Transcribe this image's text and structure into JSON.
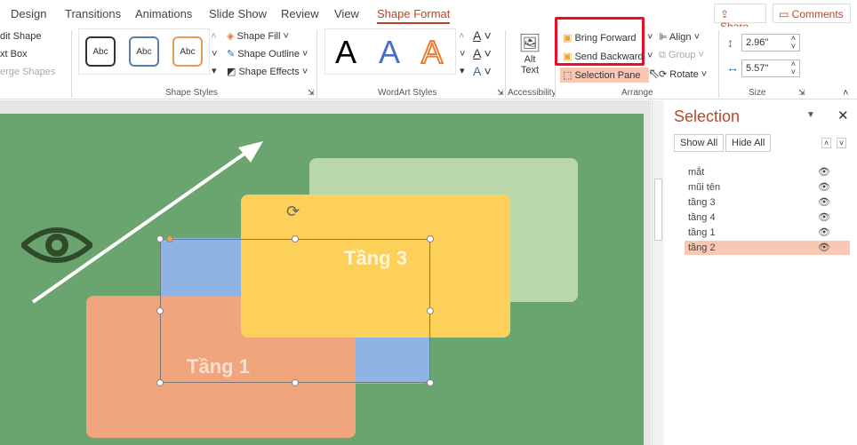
{
  "tabs": [
    "Design",
    "Transitions",
    "Animations",
    "Slide Show",
    "Review",
    "View",
    "Shape Format"
  ],
  "active_tab": "Shape Format",
  "share_label": "Share",
  "comments_label": "Comments",
  "insert_group": {
    "edit_shape": "dit Shape",
    "text_box": "xt Box",
    "merge_shapes": "erge Shapes"
  },
  "shape_styles": {
    "samples": [
      "Abc",
      "Abc",
      "Abc"
    ],
    "fill": "Shape Fill",
    "outline": "Shape Outline",
    "effects": "Shape Effects",
    "label": "Shape Styles"
  },
  "wordart": {
    "samples": [
      "A",
      "A",
      "A"
    ],
    "label": "WordArt Styles"
  },
  "accessibility": {
    "alt_text_1": "Alt",
    "alt_text_2": "Text",
    "label": "Accessibility"
  },
  "arrange": {
    "bring_forward": "Bring Forward",
    "send_backward": "Send Backward",
    "selection_pane": "Selection Pane",
    "align": "Align",
    "group": "Group",
    "rotate": "Rotate",
    "label": "Arrange"
  },
  "size": {
    "height": "2.96\"",
    "width": "5.57\"",
    "label": "Size"
  },
  "slide": {
    "shape_tang3": "Tầng 3",
    "shape_tang1": "Tầng 1"
  },
  "selection_pane": {
    "title": "Selection",
    "show_all": "Show All",
    "hide_all": "Hide All",
    "items": [
      {
        "name": "mắt",
        "selected": false
      },
      {
        "name": "mũi tên",
        "selected": false
      },
      {
        "name": "tầng 3",
        "selected": false
      },
      {
        "name": "tầng 4",
        "selected": false
      },
      {
        "name": "tầng 1",
        "selected": false
      },
      {
        "name": "tầng 2",
        "selected": true
      }
    ]
  },
  "colors": {
    "accent": "#b7472a",
    "highlight": "#e81123",
    "slide_bg": "#6aa56f",
    "selected_row": "#f8c8b4"
  }
}
